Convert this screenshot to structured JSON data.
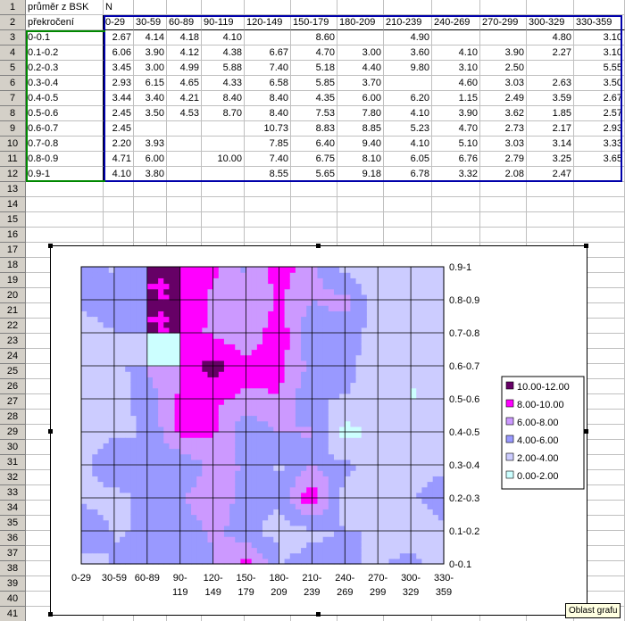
{
  "sheet": {
    "rows": [
      [
        "průměr z BSK",
        "N",
        "",
        "",
        "",
        "",
        "",
        "",
        "",
        "",
        "",
        "",
        ""
      ],
      [
        "překročení",
        "0-29",
        "30-59",
        "60-89",
        "90-119",
        "120-149",
        "150-179",
        "180-209",
        "210-239",
        "240-269",
        "270-299",
        "300-329",
        "330-359"
      ],
      [
        "0-0.1",
        "2.67",
        "4.14",
        "4.18",
        "4.10",
        "",
        "8.60",
        "",
        "4.90",
        "",
        "",
        "4.80",
        "3.10"
      ],
      [
        "0.1-0.2",
        "6.06",
        "3.90",
        "4.12",
        "4.38",
        "6.67",
        "4.70",
        "3.00",
        "3.60",
        "4.10",
        "3.90",
        "2.27",
        "3.10"
      ],
      [
        "0.2-0.3",
        "3.45",
        "3.00",
        "4.99",
        "5.88",
        "7.40",
        "5.18",
        "4.40",
        "9.80",
        "3.10",
        "2.50",
        "",
        "5.55"
      ],
      [
        "0.3-0.4",
        "2.93",
        "6.15",
        "4.65",
        "4.33",
        "6.58",
        "5.85",
        "3.70",
        "",
        "4.60",
        "3.03",
        "2.63",
        "3.50"
      ],
      [
        "0.4-0.5",
        "3.44",
        "3.40",
        "4.21",
        "8.40",
        "8.40",
        "4.35",
        "6.00",
        "6.20",
        "1.15",
        "2.49",
        "3.59",
        "2.67"
      ],
      [
        "0.5-0.6",
        "2.45",
        "3.50",
        "4.53",
        "8.70",
        "8.40",
        "7.53",
        "7.80",
        "4.10",
        "3.90",
        "3.62",
        "1.85",
        "2.57"
      ],
      [
        "0.6-0.7",
        "2.45",
        "",
        "",
        "",
        "10.73",
        "8.83",
        "8.85",
        "5.23",
        "4.70",
        "2.73",
        "2.17",
        "2.93"
      ],
      [
        "0.7-0.8",
        "2.20",
        "3.93",
        "",
        "",
        "7.85",
        "6.40",
        "9.40",
        "4.10",
        "5.10",
        "3.03",
        "3.14",
        "3.33"
      ],
      [
        "0.8-0.9",
        "4.71",
        "6.00",
        "",
        "10.00",
        "7.40",
        "6.75",
        "8.10",
        "6.05",
        "6.76",
        "2.79",
        "3.25",
        "3.65"
      ],
      [
        "0.9-1",
        "4.10",
        "3.80",
        "",
        "",
        "8.55",
        "5.65",
        "9.18",
        "6.78",
        "3.32",
        "2.08",
        "2.47",
        ""
      ],
      [
        "",
        "",
        "",
        "",
        "",
        "",
        "",
        "",
        "",
        "",
        "",
        "",
        ""
      ]
    ],
    "row_numbers": [
      "1",
      "2",
      "3",
      "4",
      "5",
      "6",
      "7",
      "8",
      "9",
      "10",
      "11",
      "12",
      "13",
      "14",
      "15",
      "16",
      "17",
      "18",
      "19",
      "20",
      "21",
      "22",
      "23",
      "24",
      "25",
      "26",
      "27",
      "28",
      "29",
      "30",
      "31",
      "32",
      "33",
      "34",
      "35",
      "36",
      "37",
      "38",
      "39",
      "40",
      "41"
    ]
  },
  "chart_data": {
    "type": "heatmap",
    "x": [
      "0-29",
      "30-59",
      "60-89",
      "90-119",
      "120-149",
      "150-179",
      "180-209",
      "210-239",
      "240-269",
      "270-299",
      "300-329",
      "330-359"
    ],
    "y": [
      "0-0.1",
      "0.1-0.2",
      "0.2-0.3",
      "0.3-0.4",
      "0.4-0.5",
      "0.5-0.6",
      "0.6-0.7",
      "0.7-0.8",
      "0.8-0.9",
      "0.9-1"
    ],
    "values": [
      [
        2.67,
        4.14,
        4.18,
        4.1,
        null,
        8.6,
        null,
        4.9,
        null,
        null,
        4.8,
        3.1
      ],
      [
        6.06,
        3.9,
        4.12,
        4.38,
        6.67,
        4.7,
        3.0,
        3.6,
        4.1,
        3.9,
        2.27,
        3.1
      ],
      [
        3.45,
        3.0,
        4.99,
        5.88,
        7.4,
        5.18,
        4.4,
        9.8,
        3.1,
        2.5,
        null,
        5.55
      ],
      [
        2.93,
        6.15,
        4.65,
        4.33,
        6.58,
        5.85,
        3.7,
        null,
        4.6,
        3.03,
        2.63,
        3.5
      ],
      [
        3.44,
        3.4,
        4.21,
        8.4,
        8.4,
        4.35,
        6.0,
        6.2,
        1.15,
        2.49,
        3.59,
        2.67
      ],
      [
        2.45,
        3.5,
        4.53,
        8.7,
        8.4,
        7.53,
        7.8,
        4.1,
        3.9,
        3.62,
        1.85,
        2.57
      ],
      [
        2.45,
        null,
        null,
        null,
        10.73,
        8.83,
        8.85,
        5.23,
        4.7,
        2.73,
        2.17,
        2.93
      ],
      [
        2.2,
        3.93,
        null,
        null,
        7.85,
        6.4,
        9.4,
        4.1,
        5.1,
        3.03,
        3.14,
        3.33
      ],
      [
        4.71,
        6.0,
        null,
        10.0,
        7.4,
        6.75,
        8.1,
        6.05,
        6.76,
        2.79,
        3.25,
        3.65
      ],
      [
        4.1,
        3.8,
        null,
        null,
        8.55,
        5.65,
        9.18,
        6.78,
        3.32,
        2.08,
        2.47,
        null
      ]
    ],
    "x_tick_labels": [
      [
        "0-29",
        ""
      ],
      [
        "30-59",
        ""
      ],
      [
        "60-89",
        ""
      ],
      [
        "90-",
        "119"
      ],
      [
        "120-",
        "149"
      ],
      [
        "150-",
        "179"
      ],
      [
        "180-",
        "209"
      ],
      [
        "210-",
        "239"
      ],
      [
        "240-",
        "269"
      ],
      [
        "270-",
        "299"
      ],
      [
        "300-",
        "329"
      ],
      [
        "330-",
        "359"
      ]
    ],
    "legend": [
      {
        "label": "10.00-12.00",
        "color": "#660066"
      },
      {
        "label": "8.00-10.00",
        "color": "#ff00ff"
      },
      {
        "label": "6.00-8.00",
        "color": "#cc99ff"
      },
      {
        "label": "4.00-6.00",
        "color": "#9999ff"
      },
      {
        "label": "2.00-4.00",
        "color": "#ccccff"
      },
      {
        "label": "0.00-2.00",
        "color": "#ccffff"
      }
    ],
    "legend_position": "right",
    "grid": true
  },
  "tooltip": "Oblast grafu"
}
